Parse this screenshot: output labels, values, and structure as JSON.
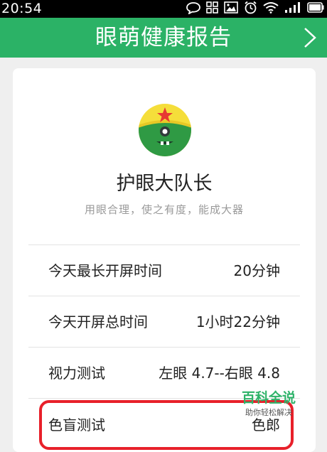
{
  "status": {
    "time": "20:54"
  },
  "header": {
    "title": "眼萌健康报告"
  },
  "profile": {
    "name": "护眼大队长",
    "motto": "用眼合理，使之有度，能成大器"
  },
  "stats": [
    {
      "label": "今天最长开屏时间",
      "value": "20分钟"
    },
    {
      "label": "今天开屏总时间",
      "value": "1小时22分钟"
    },
    {
      "label": "视力测试",
      "value": "左眼 4.7--右眼 4.8"
    },
    {
      "label": "色盲测试",
      "value": "色郎"
    }
  ],
  "watermark": {
    "title": "百科全说",
    "subtitle": "助你轻松解决"
  },
  "colors": {
    "brand": "#2bb266",
    "highlight": "#e8202a"
  }
}
